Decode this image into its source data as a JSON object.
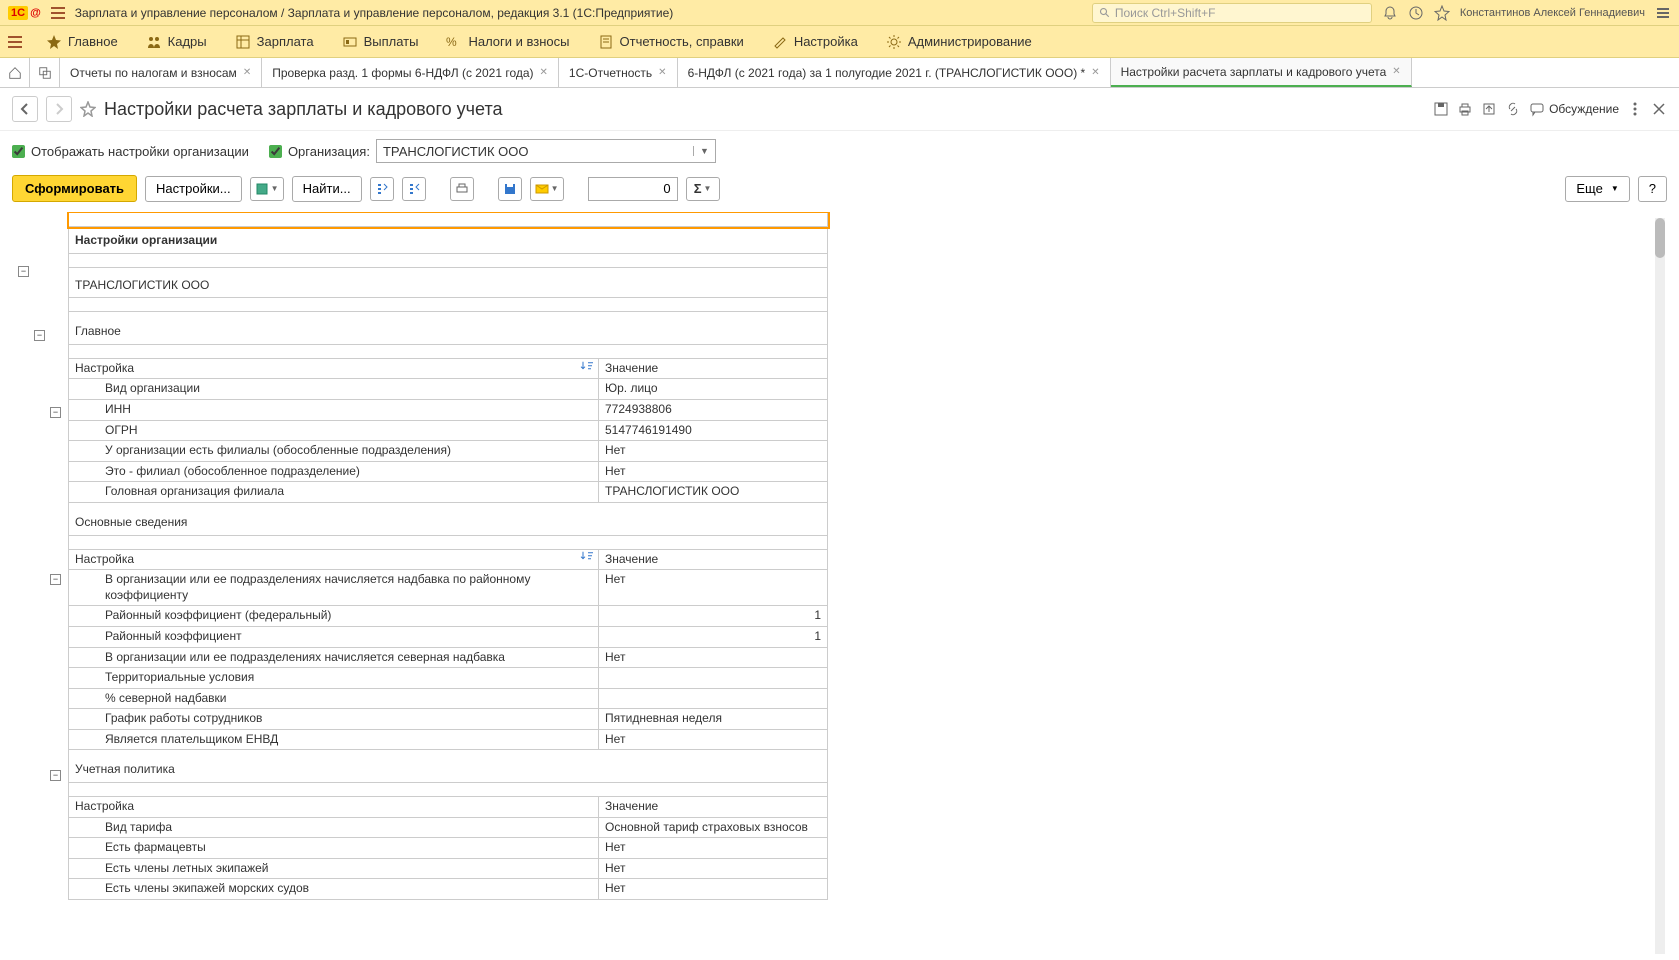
{
  "titlebar": {
    "app_title": "Зарплата и управление персоналом / Зарплата и управление персоналом, редакция 3.1  (1С:Предприятие)",
    "search_placeholder": "Поиск Ctrl+Shift+F",
    "user": "Константинов Алексей Геннадиевич"
  },
  "mainmenu": [
    {
      "label": "Главное",
      "icon": "star"
    },
    {
      "label": "Кадры",
      "icon": "people"
    },
    {
      "label": "Зарплата",
      "icon": "table"
    },
    {
      "label": "Выплаты",
      "icon": "money"
    },
    {
      "label": "Налоги и взносы",
      "icon": "percent"
    },
    {
      "label": "Отчетность, справки",
      "icon": "doc"
    },
    {
      "label": "Настройка",
      "icon": "wrench"
    },
    {
      "label": "Администрирование",
      "icon": "gear"
    }
  ],
  "tabs": [
    {
      "label": "Отчеты по налогам и взносам",
      "active": false
    },
    {
      "label": "Проверка разд. 1 формы 6-НДФЛ (с 2021 года)",
      "active": false
    },
    {
      "label": "1С-Отчетность",
      "active": false
    },
    {
      "label": "6-НДФЛ (с 2021 года) за 1 полугодие 2021 г. (ТРАНСЛОГИСТИК ООО) *",
      "active": false
    },
    {
      "label": "Настройки расчета зарплаты и кадрового учета",
      "active": true
    }
  ],
  "form": {
    "title": "Настройки расчета зарплаты и кадрового учета",
    "discuss_label": "Обсуждение"
  },
  "filters": {
    "show_org_settings": "Отображать настройки организации",
    "org_label": "Организация:",
    "org_value": "ТРАНСЛОГИСТИК ООО"
  },
  "toolbar": {
    "generate": "Сформировать",
    "settings": "Настройки...",
    "find": "Найти...",
    "num_value": "0",
    "more": "Еще"
  },
  "report": {
    "title": "Настройки организации",
    "org_name": "ТРАНСЛОГИСТИК ООО",
    "section_main": "Главное",
    "col_setting": "Настройка",
    "col_value": "Значение",
    "main_rows": [
      {
        "k": "Вид организации",
        "v": "Юр. лицо"
      },
      {
        "k": "ИНН",
        "v": "7724938806"
      },
      {
        "k": "ОГРН",
        "v": "5147746191490"
      },
      {
        "k": "У организации есть филиалы (обособленные подразделения)",
        "v": "Нет"
      },
      {
        "k": "Это - филиал (обособленное подразделение)",
        "v": "Нет"
      },
      {
        "k": "Головная организация филиала",
        "v": "ТРАНСЛОГИСТИК ООО"
      }
    ],
    "section_basic": "Основные сведения",
    "basic_rows": [
      {
        "k": "В организации или ее подразделениях начисляется надбавка по районному коэффициенту",
        "v": "Нет",
        "r": false
      },
      {
        "k": "Районный коэффициент (федеральный)",
        "v": "1",
        "r": true
      },
      {
        "k": "Районный коэффициент",
        "v": "1",
        "r": true
      },
      {
        "k": "В организации или ее подразделениях начисляется северная надбавка",
        "v": "Нет",
        "r": false
      },
      {
        "k": "Территориальные условия",
        "v": "",
        "r": false
      },
      {
        "k": "% северной надбавки",
        "v": "",
        "r": false
      },
      {
        "k": "График работы сотрудников",
        "v": "Пятидневная неделя",
        "r": false
      },
      {
        "k": "Является плательщиком ЕНВД",
        "v": "Нет",
        "r": false
      }
    ],
    "section_policy": "Учетная политика",
    "policy_rows": [
      {
        "k": "Вид тарифа",
        "v": "Основной тариф страховых взносов"
      },
      {
        "k": "Есть фармацевты",
        "v": "Нет"
      },
      {
        "k": "Есть члены летных экипажей",
        "v": "Нет"
      },
      {
        "k": "Есть члены экипажей морских судов",
        "v": "Нет"
      }
    ]
  }
}
